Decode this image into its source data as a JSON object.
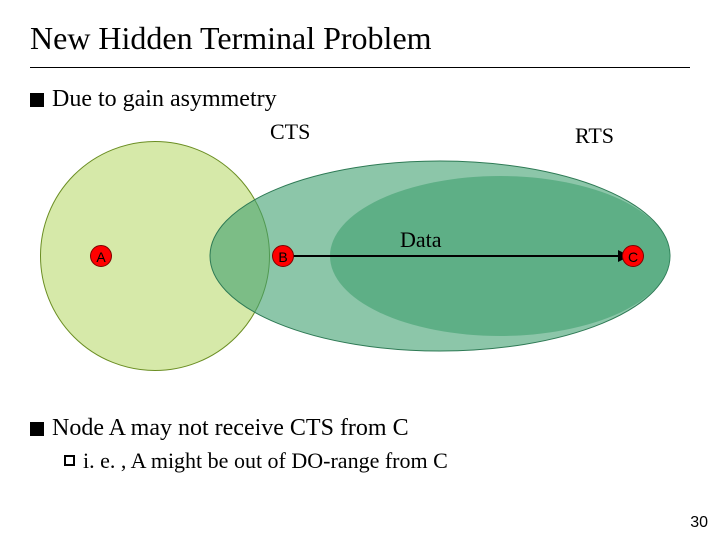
{
  "title": "New Hidden Terminal Problem",
  "bullets": {
    "main1": "Due to gain asymmetry",
    "main2": "Node A may not receive CTS from C",
    "sub1": "i. e. , A might be out of DO-range from C"
  },
  "labels": {
    "cts": "CTS",
    "rts": "RTS",
    "data": "Data"
  },
  "nodes": {
    "a": "A",
    "b": "B",
    "c": "C"
  },
  "page": "30",
  "colors": {
    "circleA_fill": "#d6e9a9",
    "circleA_stroke": "#6b8e23",
    "lens_fill": "#3fa06f",
    "lens_opacity": 0.75,
    "node_fill": "#ff0000",
    "node_stroke": "#800000"
  }
}
